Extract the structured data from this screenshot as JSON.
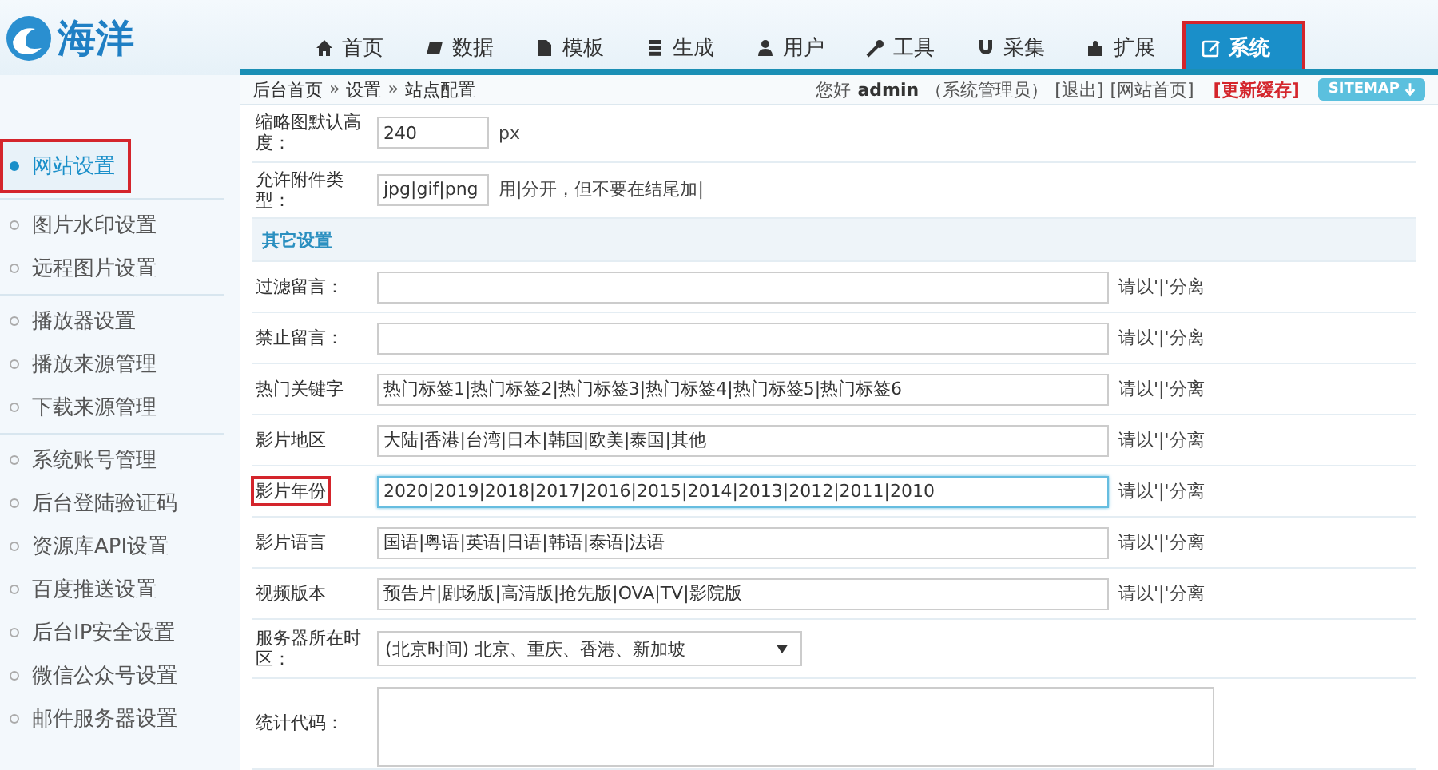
{
  "logo": {
    "text": "海洋"
  },
  "nav": [
    {
      "label": "首页",
      "selected": false,
      "highlighted": false
    },
    {
      "label": "数据",
      "selected": false,
      "highlighted": false
    },
    {
      "label": "模板",
      "selected": false,
      "highlighted": false
    },
    {
      "label": "生成",
      "selected": false,
      "highlighted": false
    },
    {
      "label": "用户",
      "selected": false,
      "highlighted": false
    },
    {
      "label": "工具",
      "selected": false,
      "highlighted": false
    },
    {
      "label": "采集",
      "selected": false,
      "highlighted": false
    },
    {
      "label": "扩展",
      "selected": false,
      "highlighted": false
    },
    {
      "label": "系统",
      "selected": true,
      "highlighted": true
    }
  ],
  "breadcrumb": [
    "后台首页",
    "设置",
    "站点配置"
  ],
  "breadcrumb_separator": "»",
  "user_bar": {
    "greeting": "您好",
    "username": "admin",
    "role": "（系统管理员）",
    "logout": "[退出]",
    "site_home": "[网站首页]",
    "refresh_cache": "[更新缓存]",
    "sitemap": "SITEMAP"
  },
  "sidebar": {
    "groups": [
      {
        "items": [
          {
            "label": "网站设置",
            "selected": true,
            "highlighted": true
          }
        ]
      },
      {
        "items": [
          {
            "label": "图片水印设置",
            "selected": false,
            "highlighted": false
          },
          {
            "label": "远程图片设置",
            "selected": false,
            "highlighted": false
          }
        ]
      },
      {
        "items": [
          {
            "label": "播放器设置",
            "selected": false,
            "highlighted": false
          },
          {
            "label": "播放来源管理",
            "selected": false,
            "highlighted": false
          },
          {
            "label": "下载来源管理",
            "selected": false,
            "highlighted": false
          }
        ]
      },
      {
        "items": [
          {
            "label": "系统账号管理",
            "selected": false,
            "highlighted": false
          },
          {
            "label": "后台登陆验证码",
            "selected": false,
            "highlighted": false
          },
          {
            "label": "资源库API设置",
            "selected": false,
            "highlighted": false
          },
          {
            "label": "百度推送设置",
            "selected": false,
            "highlighted": false
          },
          {
            "label": "后台IP安全设置",
            "selected": false,
            "highlighted": false
          },
          {
            "label": "微信公众号设置",
            "selected": false,
            "highlighted": false
          },
          {
            "label": "邮件服务器设置",
            "selected": false,
            "highlighted": false
          }
        ]
      }
    ]
  },
  "form": {
    "rows": [
      {
        "kind": "short",
        "label": "缩略图默认高度：",
        "value": "240",
        "hint": "px",
        "highlighted": false,
        "focused": false
      },
      {
        "kind": "short",
        "label": "允许附件类型：",
        "value": "jpg|gif|png",
        "hint": "用|分开，但不要在结尾加|",
        "highlighted": false,
        "focused": false
      },
      {
        "kind": "section",
        "label": "其它设置"
      },
      {
        "kind": "text",
        "label": "过滤留言：",
        "value": "",
        "hint": "请以'|'分离",
        "highlighted": false,
        "focused": false
      },
      {
        "kind": "text",
        "label": "禁止留言：",
        "value": "",
        "hint": "请以'|'分离",
        "highlighted": false,
        "focused": false
      },
      {
        "kind": "text",
        "label": "热门关键字",
        "value": "热门标签1|热门标签2|热门标签3|热门标签4|热门标签5|热门标签6",
        "hint": "请以'|'分离",
        "highlighted": false,
        "focused": false
      },
      {
        "kind": "text",
        "label": "影片地区",
        "value": "大陆|香港|台湾|日本|韩国|欧美|泰国|其他",
        "hint": "请以'|'分离",
        "highlighted": false,
        "focused": false
      },
      {
        "kind": "text",
        "label": "影片年份",
        "value": "2020|2019|2018|2017|2016|2015|2014|2013|2012|2011|2010",
        "hint": "请以'|'分离",
        "highlighted": true,
        "focused": true
      },
      {
        "kind": "text",
        "label": "影片语言",
        "value": "国语|粤语|英语|日语|韩语|泰语|法语",
        "hint": "请以'|'分离",
        "highlighted": false,
        "focused": false
      },
      {
        "kind": "text",
        "label": "视频版本",
        "value": "预告片|剧场版|高清版|抢先版|OVA|TV|影院版",
        "hint": "请以'|'分离",
        "highlighted": false,
        "focused": false
      },
      {
        "kind": "select",
        "label": "服务器所在时区：",
        "value": "(北京时间) 北京、重庆、香港、新加坡",
        "highlighted": false,
        "focused": false
      },
      {
        "kind": "textarea",
        "label": "统计代码：",
        "value": "",
        "highlighted": false,
        "focused": false
      }
    ]
  }
}
